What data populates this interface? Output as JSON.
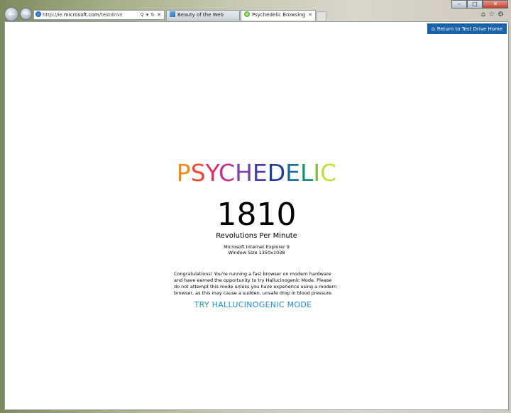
{
  "browser": {
    "address_url": "http://ie.microsoft.com/testdrive/Performance",
    "url_prefix": "http://ie.",
    "url_host": "microsoft.com",
    "url_path": "/testdrive/Performan",
    "tabs": [
      {
        "label": "Beauty of the Web"
      },
      {
        "label": "Psychedelic Browsing"
      }
    ]
  },
  "page": {
    "return_button": "Return to Test Drive Home",
    "title_letters": [
      {
        "char": "P",
        "color": "#f08a1c"
      },
      {
        "char": "S",
        "color": "#e94b36"
      },
      {
        "char": "Y",
        "color": "#e02d5d"
      },
      {
        "char": "C",
        "color": "#c0308f"
      },
      {
        "char": "H",
        "color": "#7c3fa8"
      },
      {
        "char": "E",
        "color": "#4a3ca8"
      },
      {
        "char": "D",
        "color": "#1c3f9c"
      },
      {
        "char": "E",
        "color": "#1a6aa3"
      },
      {
        "char": "L",
        "color": "#18906f"
      },
      {
        "char": "I",
        "color": "#7cc133"
      },
      {
        "char": "C",
        "color": "#c7dc3a"
      }
    ],
    "rpm_value": "1810",
    "rpm_label": "Revolutions Per Minute",
    "browser_name": "Microsoft Internet Explorer 9",
    "window_size": "Window Size 1350x1038",
    "congrats_text": "Congratulations! You're running a fast browser on modern hardware and have earned the opportunity to try Hallucinogenic Mode. Please do not attempt this mode unless you have experience using a modern browser, as this may cause a sudden, unsafe drop in blood pressure.",
    "mode_link": "TRY HALLUCINOGENIC MODE"
  },
  "icons": {
    "back": "back-arrow-icon",
    "forward": "forward-arrow-icon",
    "home": "home-icon",
    "favorites": "star-icon",
    "tools": "gear-icon"
  }
}
